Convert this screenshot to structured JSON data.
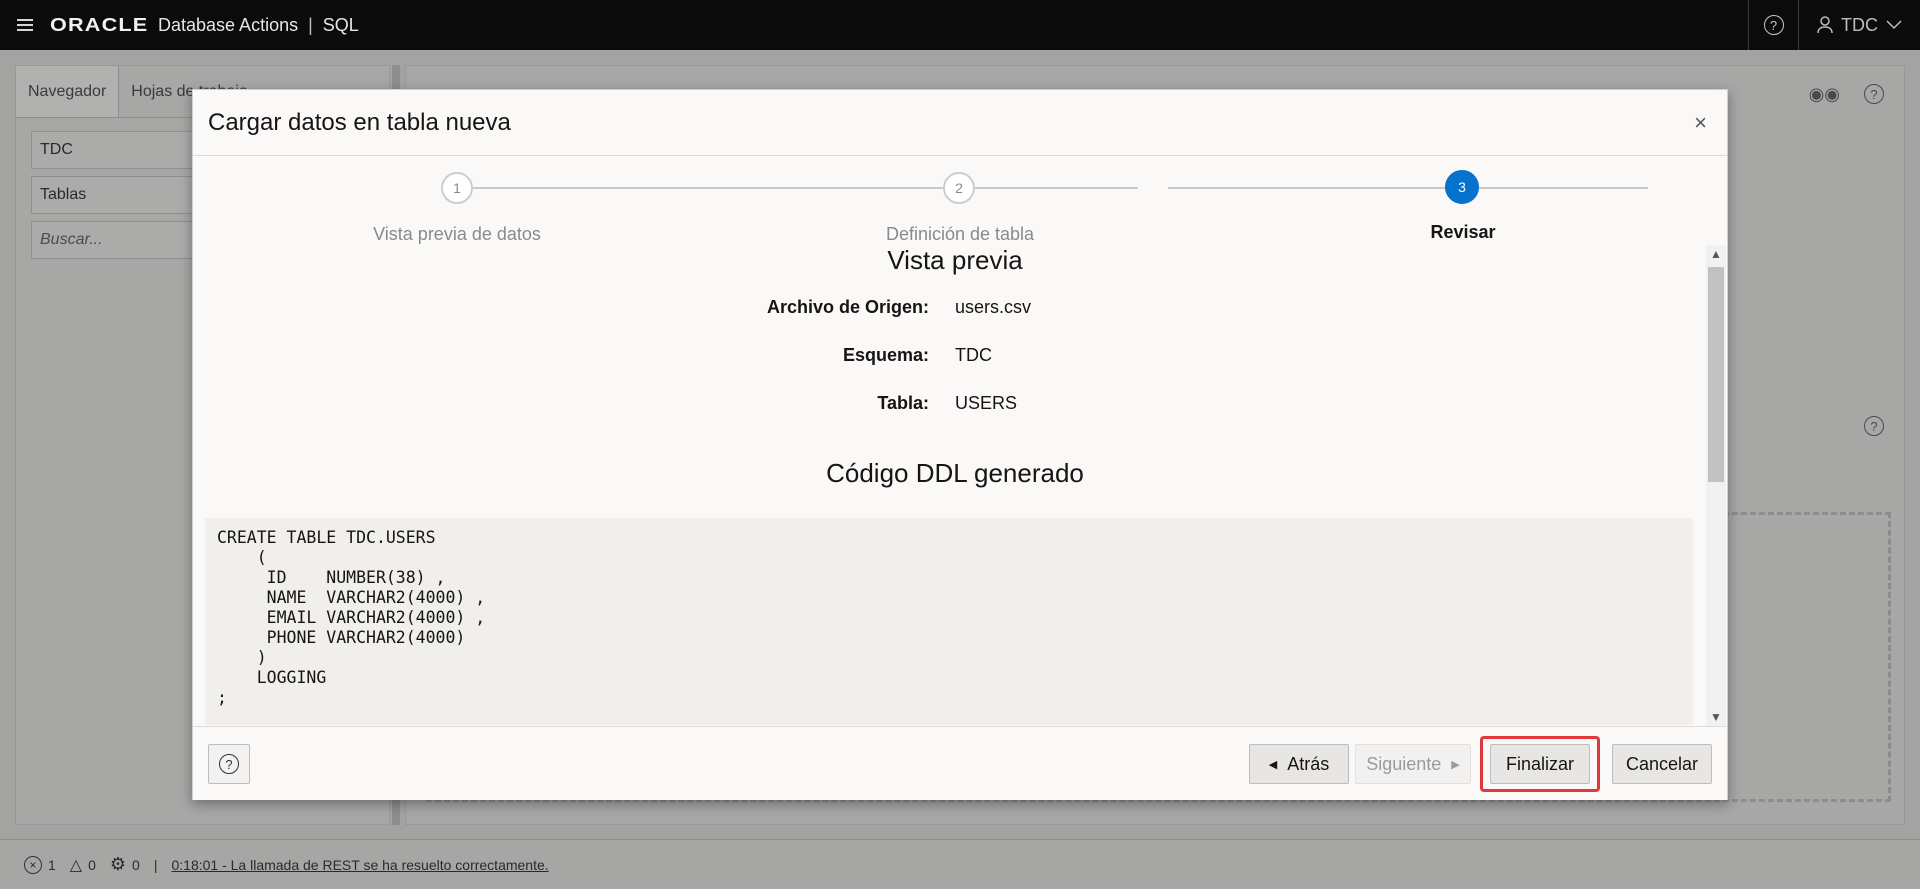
{
  "header": {
    "logo": "ORACLE",
    "product": "Database Actions",
    "separator": "|",
    "section": "SQL",
    "user": "TDC",
    "user_chevron": "chevron-down-icon"
  },
  "navigator": {
    "tabs": [
      "Navegador",
      "Hojas de trabajo"
    ],
    "schema": "TDC",
    "object_type": "Tablas",
    "search_placeholder": "Buscar..."
  },
  "dialog": {
    "title": "Cargar datos en tabla nueva",
    "close": "×",
    "steps": [
      {
        "number": "1",
        "label": "Vista previa de datos",
        "active": false
      },
      {
        "number": "2",
        "label": "Definición de tabla",
        "active": false
      },
      {
        "number": "3",
        "label": "Revisar",
        "active": true
      }
    ],
    "preview_title": "Vista previa",
    "fields": [
      {
        "key": "Archivo de Origen:",
        "value": "users.csv"
      },
      {
        "key": "Esquema:",
        "value": "TDC"
      },
      {
        "key": "Tabla:",
        "value": "USERS"
      }
    ],
    "ddl_title": "Código DDL generado",
    "ddl": "CREATE TABLE TDC.USERS\n    (\n     ID    NUMBER(38) ,\n     NAME  VARCHAR2(4000) ,\n     EMAIL VARCHAR2(4000) ,\n     PHONE VARCHAR2(4000)\n    )\n    LOGGING\n;",
    "buttons": {
      "back": "Atrás",
      "next": "Siguiente",
      "finish": "Finalizar",
      "cancel": "Cancelar"
    }
  },
  "status": {
    "errors": "1",
    "warnings": "0",
    "processes": "0",
    "separator": "|",
    "message": "0:18:01 - La llamada de REST se ha resuelto correctamente."
  },
  "colors": {
    "accent": "#0572ce",
    "highlight": "#e0383b",
    "header_bg": "#0c0b0b"
  }
}
